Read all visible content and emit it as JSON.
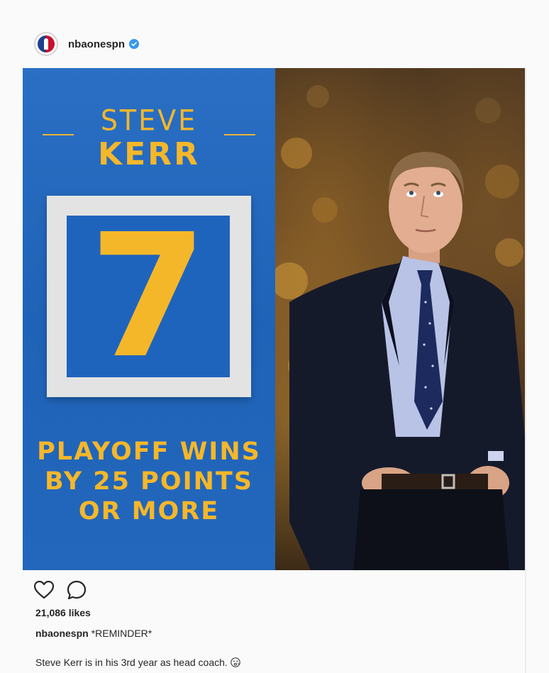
{
  "post": {
    "username": "nbaonespn",
    "verified": true,
    "avatar_icon": "nba-logo-avatar",
    "image": {
      "first_name": "STEVE",
      "last_name": "KERR",
      "stat_value": "7",
      "caption_lines": [
        "PLAYOFF WINS",
        "BY 25 POINTS",
        "OR MORE"
      ],
      "photo_subject": "coach-photo",
      "colors": {
        "panel_blue": "#1f63b8",
        "gold": "#f5b72a",
        "box_gray": "#e3e3e3"
      }
    },
    "actions": {
      "like_icon": "heart-icon",
      "comment_icon": "comment-icon"
    },
    "likes": "21,086 likes",
    "caption": {
      "username": "nbaonespn",
      "text": "*REMINDER*",
      "second_line": "Steve Kerr is in his 3rd year as head coach."
    },
    "colors": {
      "verified": "#3897f0",
      "text": "#262626"
    }
  }
}
